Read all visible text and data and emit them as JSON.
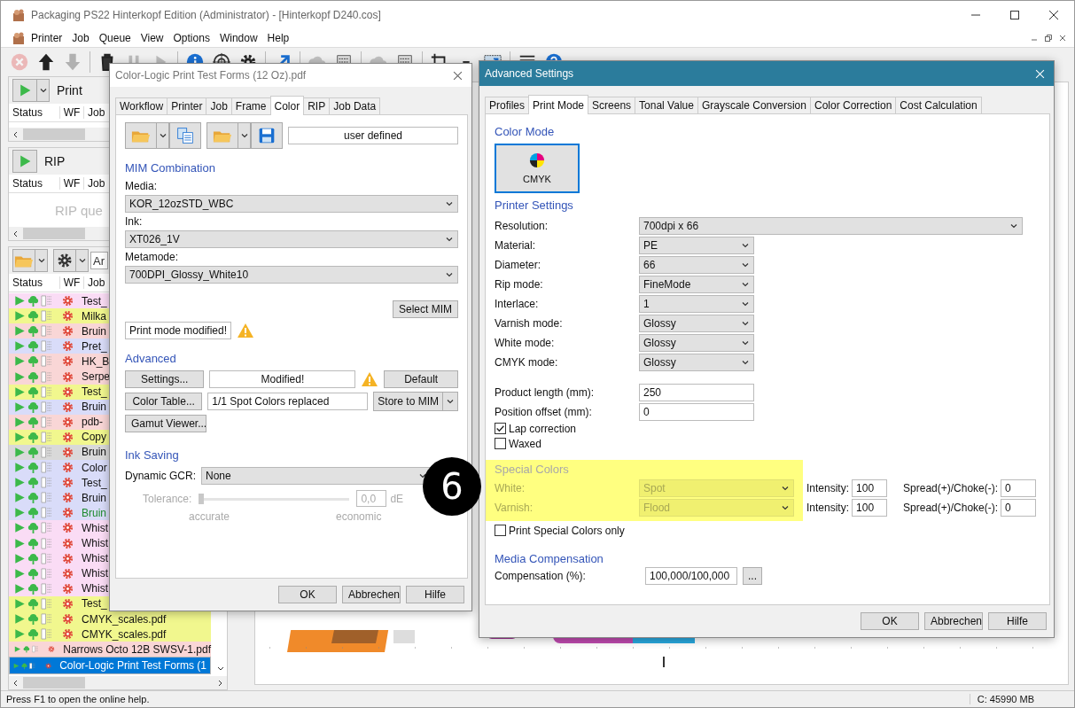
{
  "window": {
    "title": "Packaging PS22 Hinterkopf Edition (Administrator) - [Hinterkopf D240.cos]",
    "menu": [
      "Printer",
      "Job",
      "Queue",
      "View",
      "Options",
      "Window",
      "Help"
    ]
  },
  "toolbar": [
    {
      "kind": "cancel",
      "disabled": true
    },
    {
      "kind": "up",
      "disabled": false
    },
    {
      "kind": "down",
      "disabled": true
    },
    {
      "kind": "trash",
      "disabled": false
    },
    {
      "kind": "pause",
      "disabled": true
    },
    {
      "kind": "play",
      "disabled": true
    },
    {
      "kind": "info",
      "disabled": false
    },
    {
      "kind": "target",
      "disabled": false
    },
    {
      "kind": "gear",
      "disabled": false
    },
    {
      "kind": "export",
      "disabled": false
    },
    {
      "kind": "cloud",
      "disabled": true
    },
    {
      "kind": "binary",
      "disabled": false
    },
    {
      "kind": "cloud",
      "disabled": true
    },
    {
      "kind": "binary",
      "disabled": false
    },
    {
      "kind": "crop",
      "disabled": false
    },
    {
      "kind": "minus",
      "disabled": false
    },
    {
      "kind": "image",
      "disabled": false
    },
    {
      "kind": "list",
      "disabled": false
    },
    {
      "kind": "help",
      "disabled": false
    }
  ],
  "print_queue": {
    "title": "Print",
    "columns": [
      "Status",
      "WF",
      "Job"
    ]
  },
  "rip_queue": {
    "title": "RIP",
    "columns": [
      "Status",
      "WF",
      "Job"
    ],
    "placeholder": "RIP que"
  },
  "job_list": {
    "search_placeholder": "Ar",
    "columns": [
      "Status",
      "WF",
      "Job"
    ],
    "rows": [
      {
        "name": "Test_",
        "color": "#fadcf5",
        "selected": false,
        "highlighted": false
      },
      {
        "name": "Milka",
        "color": "#f1f78e",
        "selected": false,
        "highlighted": false
      },
      {
        "name": "Bruin",
        "color": "#f9d6d6",
        "selected": false,
        "highlighted": false
      },
      {
        "name": "Pret_",
        "color": "#d9dcf9",
        "selected": false,
        "highlighted": false
      },
      {
        "name": "HK_B",
        "color": "#f9d6d6",
        "selected": false,
        "highlighted": false
      },
      {
        "name": "Serpe",
        "color": "#f9d6d6",
        "selected": false,
        "highlighted": false
      },
      {
        "name": "Test_",
        "color": "#f1f78e",
        "selected": false,
        "highlighted": false
      },
      {
        "name": "Bruin",
        "color": "#d9dcf9",
        "selected": false,
        "highlighted": false
      },
      {
        "name": "pdb-",
        "color": "#f9d6d6",
        "selected": false,
        "highlighted": false
      },
      {
        "name": "Copy",
        "color": "#f1f78e",
        "selected": false,
        "highlighted": false
      },
      {
        "name": "Bruin",
        "color": "#d9d9d9",
        "selected": false,
        "highlighted": false
      },
      {
        "name": "Color",
        "color": "#d9dcf9",
        "selected": false,
        "highlighted": false
      },
      {
        "name": "Test_",
        "color": "#d9dcf9",
        "selected": false,
        "highlighted": false
      },
      {
        "name": "Bruin",
        "color": "#d9dcf9",
        "selected": false,
        "highlighted": false
      },
      {
        "name": "Bruin",
        "color": "#d9dcf9",
        "selected": false,
        "highlighted": true
      },
      {
        "name": "Whist",
        "color": "#fadcf5",
        "selected": false,
        "highlighted": false
      },
      {
        "name": "Whist",
        "color": "#fadcf5",
        "selected": false,
        "highlighted": false
      },
      {
        "name": "Whist",
        "color": "#fadcf5",
        "selected": false,
        "highlighted": false
      },
      {
        "name": "Whist",
        "color": "#fadcf5",
        "selected": false,
        "highlighted": false
      },
      {
        "name": "Whist",
        "color": "#fadcf5",
        "selected": false,
        "highlighted": false
      },
      {
        "name": "Test_",
        "color": "#f1f78e",
        "selected": false,
        "highlighted": false
      },
      {
        "name": "CMYK_scales.pdf",
        "color": "#f1f78e",
        "selected": false,
        "highlighted": false
      },
      {
        "name": "CMYK_scales.pdf",
        "color": "#f1f78e",
        "selected": false,
        "highlighted": false
      },
      {
        "name": "Narrows Octo 12B SWSV-1.pdf",
        "color": "#f9d6d6",
        "selected": false,
        "highlighted": false
      },
      {
        "name": "Color-Logic Print Test Forms (1",
        "color": "#0078d7",
        "selected": true,
        "highlighted": false
      }
    ]
  },
  "status_bar": {
    "help": "Press F1 to open the online help.",
    "disk": "C: 45990 MB"
  },
  "job_dialog": {
    "title": "Color-Logic Print Test Forms (12 Oz).pdf",
    "tabs": [
      {
        "label": "Workflow",
        "selected": false
      },
      {
        "label": "Printer",
        "selected": false
      },
      {
        "label": "Job",
        "selected": false
      },
      {
        "label": "Frame",
        "selected": false
      },
      {
        "label": "Color",
        "selected": true
      },
      {
        "label": "RIP",
        "selected": false
      },
      {
        "label": "Job Data",
        "selected": false
      }
    ],
    "profile_name": "user defined",
    "mim_heading": "MIM Combination",
    "mim_fields": [
      {
        "label": "Media:",
        "value": "KOR_12ozSTD_WBC"
      },
      {
        "label": "Ink:",
        "value": "XT026_1V"
      },
      {
        "label": "Metamode:",
        "value": "700DPI_Glossy_White10"
      }
    ],
    "select_mim": "Select MIM",
    "print_mode_status": "Print mode modified!",
    "print_mode_warning": true,
    "advanced_heading": "Advanced",
    "settings_button": "Settings...",
    "settings_status": "Modified!",
    "settings_warning": true,
    "default_button": "Default",
    "color_table_button": "Color Table...",
    "color_table_status": "1/1 Spot Colors replaced",
    "store_button": "Store to MIM",
    "gamut_button": "Gamut Viewer...",
    "ink_saving_heading": "Ink Saving",
    "gcr_label": "Dynamic GCR:",
    "gcr_value": "None",
    "tolerance": {
      "label": "Tolerance:",
      "level": 0,
      "value": "0,0",
      "unit": "dE",
      "min_label": "accurate",
      "max_label": "economic",
      "disabled": true
    },
    "buttons": [
      "OK",
      "Abbrechen",
      "Hilfe"
    ]
  },
  "advanced_dialog": {
    "title": "Advanced Settings",
    "tabs": [
      {
        "label": "Profiles",
        "selected": false
      },
      {
        "label": "Print Mode",
        "selected": true
      },
      {
        "label": "Screens",
        "selected": false
      },
      {
        "label": "Tonal Value",
        "selected": false
      },
      {
        "label": "Grayscale Conversion",
        "selected": false
      },
      {
        "label": "Color Correction",
        "selected": false
      },
      {
        "label": "Cost Calculation",
        "selected": false
      }
    ],
    "color_mode_heading": "Color Mode",
    "color_modes": [
      {
        "label": "CMYK",
        "selected": true
      }
    ],
    "printer_heading": "Printer Settings",
    "settings": [
      {
        "label": "Resolution:",
        "value": "700dpi x 66",
        "kind": "wide-select"
      },
      {
        "label": "Material:",
        "value": "PE",
        "kind": "select"
      },
      {
        "label": "Diameter:",
        "value": "66",
        "kind": "select"
      },
      {
        "label": "Rip mode:",
        "value": "FineMode",
        "kind": "select"
      },
      {
        "label": "Interlace:",
        "value": "1",
        "kind": "select"
      },
      {
        "label": "Varnish mode:",
        "value": "Glossy",
        "kind": "select"
      },
      {
        "label": "White mode:",
        "value": "Glossy",
        "kind": "select"
      },
      {
        "label": "CMYK mode:",
        "value": "Glossy",
        "kind": "select"
      },
      {
        "label": "Product length (mm):",
        "value": "250",
        "kind": "input"
      },
      {
        "label": "Position offset (mm):",
        "value": "0",
        "kind": "input"
      }
    ],
    "options": [
      {
        "label": "Lap correction",
        "checked": true
      },
      {
        "label": "Waxed",
        "checked": false
      }
    ],
    "special_colors": {
      "heading": "Special Colors",
      "highlighted": true,
      "disabled": true,
      "rows": [
        {
          "label": "White:",
          "value": "Spot",
          "intensity_label": "Intensity:",
          "intensity": "100",
          "spread_label": "Spread(+)/Choke(-):",
          "spread": "0"
        },
        {
          "label": "Varnish:",
          "value": "Flood",
          "intensity_label": "Intensity:",
          "intensity": "100",
          "spread_label": "Spread(+)/Choke(-):",
          "spread": "0"
        }
      ]
    },
    "special_only": {
      "label": "Print Special Colors only",
      "checked": false
    },
    "compensation_heading": "Media Compensation",
    "compensation": {
      "label": "Compensation (%):",
      "value": "100,000/100,000",
      "button": "..."
    },
    "buttons": [
      "OK",
      "Abbrechen",
      "Hilfe"
    ]
  },
  "step_badge": "6"
}
